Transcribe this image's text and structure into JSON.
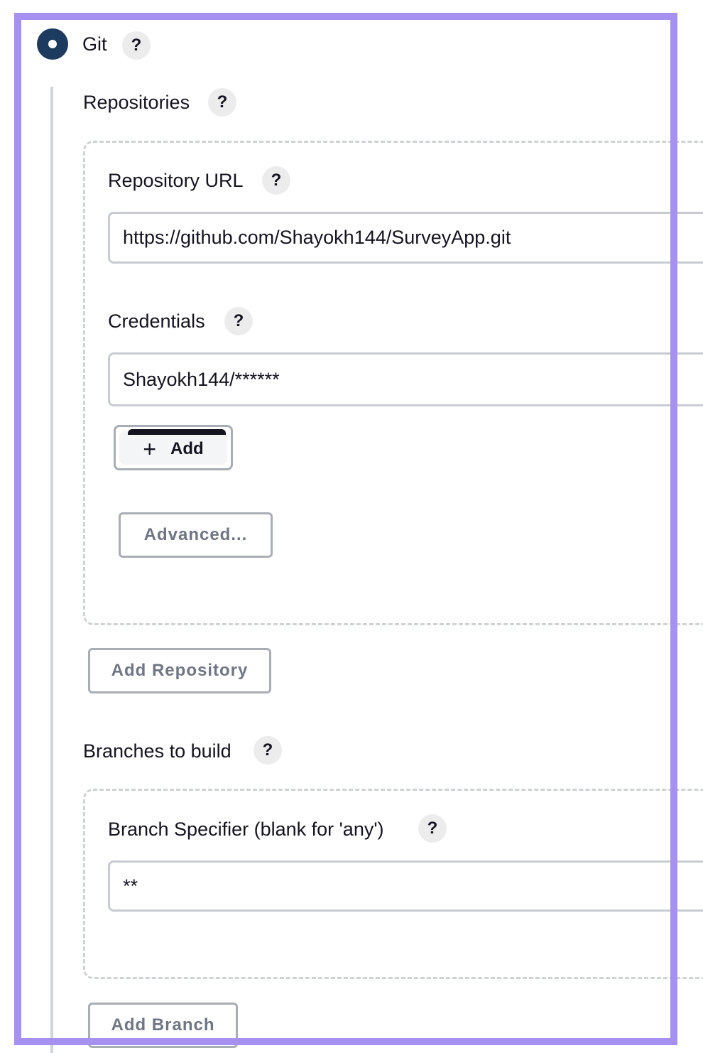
{
  "scm": {
    "option_label": "Git",
    "help_symbol": "?"
  },
  "repositories": {
    "section_label": "Repositories",
    "url_label": "Repository URL",
    "url_value": "https://github.com/Shayokh144/SurveyApp.git",
    "credentials_label": "Credentials",
    "credentials_value": "Shayokh144/******",
    "add_label": "Add",
    "advanced_label": "Advanced...",
    "add_repository_label": "Add Repository"
  },
  "branches": {
    "section_label": "Branches to build",
    "specifier_label": "Branch Specifier (blank for 'any')",
    "specifier_value": "**",
    "add_branch_label": "Add Branch"
  },
  "colors": {
    "radio_fill": "#1c3b5e",
    "highlight_frame": "#a690f0"
  },
  "icons": {
    "help": "question-mark-icon",
    "add": "plus-icon"
  }
}
